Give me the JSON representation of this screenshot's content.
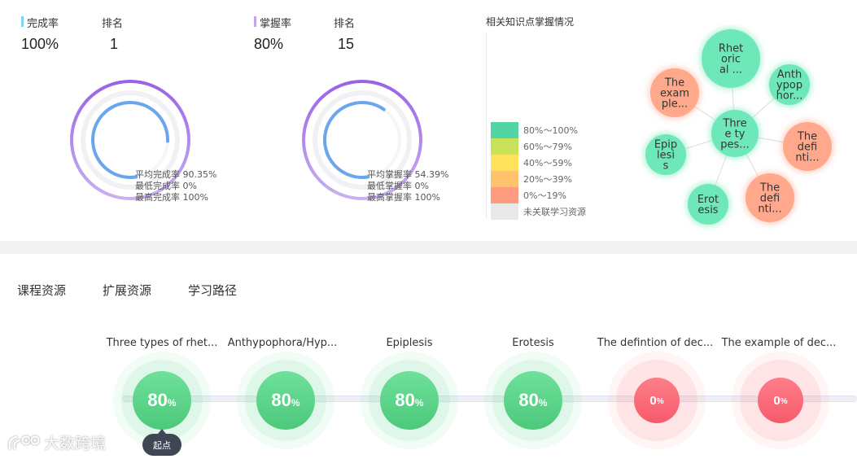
{
  "completion": {
    "label": "完成率",
    "value": "100%",
    "rank_label": "排名",
    "rank": "1",
    "accent": "#7ed3f2",
    "fraction": 1.0,
    "legend": [
      "平均完成率 90.35%",
      "最低完成率 0%",
      "最高完成率 100%"
    ]
  },
  "mastery": {
    "label": "掌握率",
    "value": "80%",
    "rank_label": "排名",
    "rank": "15",
    "accent": "#c9a2ec",
    "fraction": 0.8,
    "legend": [
      "平均掌握率 54.39%",
      "最低掌握率 0%",
      "最高掌握率 100%"
    ]
  },
  "knowledge": {
    "title": "相关知识点掌握情况",
    "legend": [
      {
        "label": "80%～100%",
        "color": "#52d5a4"
      },
      {
        "label": "60%～79%",
        "color": "#c8e25a"
      },
      {
        "label": "40%～59%",
        "color": "#ffe15c"
      },
      {
        "label": "20%～39%",
        "color": "#ffc36e"
      },
      {
        "label": "0%～19%",
        "color": "#ff9b7f"
      },
      {
        "label": "未关联学习资源",
        "color": "#e9e9e9"
      }
    ],
    "center": {
      "label": "Three types...",
      "lines": [
        "Thre",
        "e ty",
        "pes..."
      ],
      "level": "green"
    },
    "nodes": [
      {
        "label": "Rhetorical ...",
        "lines": [
          "Rhet",
          "oric",
          "al ..."
        ],
        "level": "green"
      },
      {
        "label": "Anthypophor...",
        "lines": [
          "Anth",
          "ypop",
          "hor..."
        ],
        "level": "green"
      },
      {
        "label": "The definti...",
        "lines": [
          "The",
          "defi",
          "nti..."
        ],
        "level": "orange"
      },
      {
        "label": "The definti...",
        "lines": [
          "The",
          "defi",
          "nti..."
        ],
        "level": "orange"
      },
      {
        "label": "Erotesis",
        "lines": [
          "Erot",
          "esis"
        ],
        "level": "green"
      },
      {
        "label": "Epiplesis",
        "lines": [
          "Epip",
          "lesi",
          "s"
        ],
        "level": "green"
      },
      {
        "label": "The example...",
        "lines": [
          "The",
          "exam",
          "ple..."
        ],
        "level": "orange"
      }
    ]
  },
  "tabs": [
    "课程资源",
    "扩展资源",
    "学习路径"
  ],
  "path": {
    "start_label": "起点",
    "steps": [
      {
        "title": "Three types of rhet...",
        "percent": "80",
        "status": "green"
      },
      {
        "title": "Anthypophora/Hyp...",
        "percent": "80",
        "status": "green"
      },
      {
        "title": "Epiplesis",
        "percent": "80",
        "status": "green"
      },
      {
        "title": "Erotesis",
        "percent": "80",
        "status": "green"
      },
      {
        "title": "The defintion of dec...",
        "percent": "0",
        "status": "red"
      },
      {
        "title": "The example of dec...",
        "percent": "0",
        "status": "red"
      }
    ],
    "percent_sign": "%"
  },
  "watermark": {
    "text": "大数跨境"
  }
}
